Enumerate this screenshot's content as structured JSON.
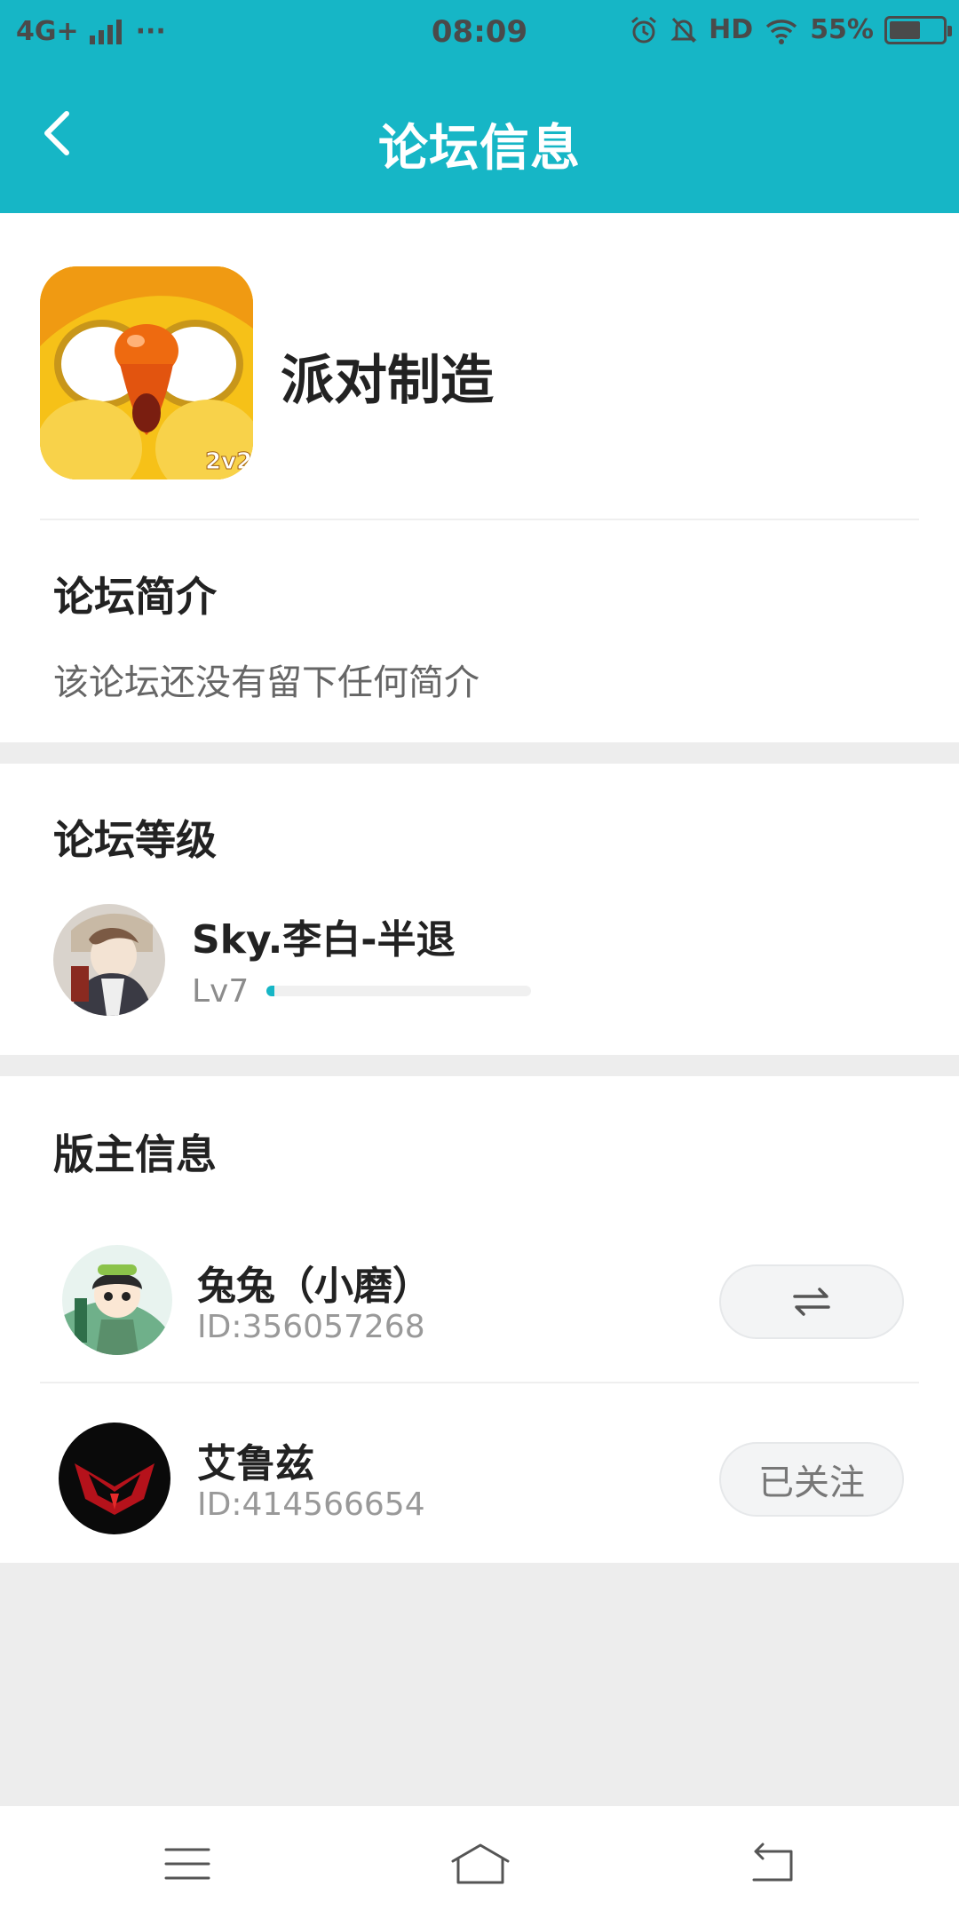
{
  "status_bar": {
    "network": "4G+",
    "more": "···",
    "time": "08:09",
    "hd": "HD",
    "battery": "55%",
    "icons": [
      "signal-icon",
      "alarm-icon",
      "mute-bell-icon",
      "wifi-icon",
      "battery-icon"
    ]
  },
  "header": {
    "title": "论坛信息",
    "back_icon": "back-chevron-icon"
  },
  "forum": {
    "name": "派对制造",
    "icon_badge": "2v2",
    "intro_title": "论坛简介",
    "intro_text": "该论坛还没有留下任何简介"
  },
  "level_section": {
    "title": "论坛等级",
    "user": {
      "name": "Sky.李白-半退",
      "level": "Lv7",
      "progress": 0.03
    }
  },
  "moderators_section": {
    "title": "版主信息",
    "items": [
      {
        "name": "兔兔（小磨）",
        "id": "ID:356057268",
        "action_icon": "swap-arrows-icon",
        "action_label": ""
      },
      {
        "name": "艾鲁兹",
        "id": "ID:414566654",
        "action_label": "已关注"
      }
    ]
  },
  "nav": {
    "icons": [
      "menu-icon",
      "home-icon",
      "return-icon"
    ]
  },
  "colors": {
    "accent": "#16b6c6",
    "background": "#ededed"
  }
}
